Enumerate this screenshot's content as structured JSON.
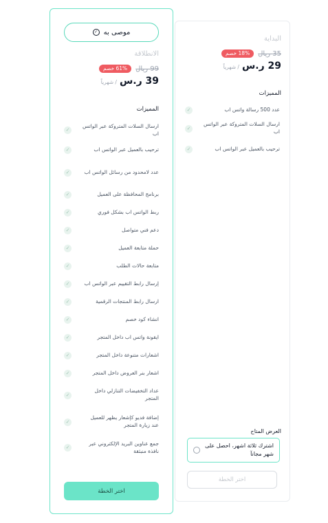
{
  "basic_plan": {
    "name": "البداية",
    "old_price": "35 ريال",
    "discount": "18% خصم",
    "price": "29 ر.س",
    "period": "/ شهرياً",
    "features_title": "المميزات",
    "features": [
      "عدد 500 رسالة واتس اب",
      "ارسال السلات المتروكة عبر الواتس اب",
      "ترحيب بالعميل عبر الواتس اب"
    ],
    "offer_title": "العرض المتاح",
    "offer_text": "اشترك ثلاثة اشهر، احصل على شهر مجانآ",
    "choose_label": "اختر الخطة"
  },
  "featured_plan": {
    "recommended_label": "موصى به",
    "name": "الانطلاقة",
    "old_price": "99 ريال",
    "discount": "61% خصم",
    "price": "39 ر.س",
    "period": "/ شهرياً",
    "features_title": "المميزات",
    "features": [
      "ارسال السلات المتروكة عبر الواتس اب",
      "ترحيب بالعميل عبر الواتس اب",
      "عدد لامحدود من رسائل الواتس اب",
      "برنامج المحافظة على العميل",
      "ربط الواتس اب بشكل فوري",
      "دعم فني متواصل",
      "حملة متابعة العميل",
      "متابعة حالات الطلب",
      "إرسال رابط التقييم عبر الواتس اب",
      "ارسال رابط المنتجات الرقمية",
      "انشاء كود خصم",
      "ايقونة واتس اب داخل المتجر",
      "اشعارات متنوعة داخل المتجر",
      "اشعار بنر العروض داخل المتجر",
      "عداد التخفيضات التنازلي داخل المتجر",
      "إضافة فديو كإشعار يظهر للعميل عند زيارة المتجر",
      "جمع عناوين البريد الإلكتروني عبر نافذة منبثقة"
    ],
    "choose_label": "اختر الخطة"
  },
  "colors": {
    "accent": "#6be4c8",
    "discount_badge": "#ef5b61",
    "tick_bg": "#e8f3ee"
  },
  "icons": {
    "recommended": "check-circle-icon",
    "feature": "check-icon",
    "offer": "radio-icon"
  }
}
